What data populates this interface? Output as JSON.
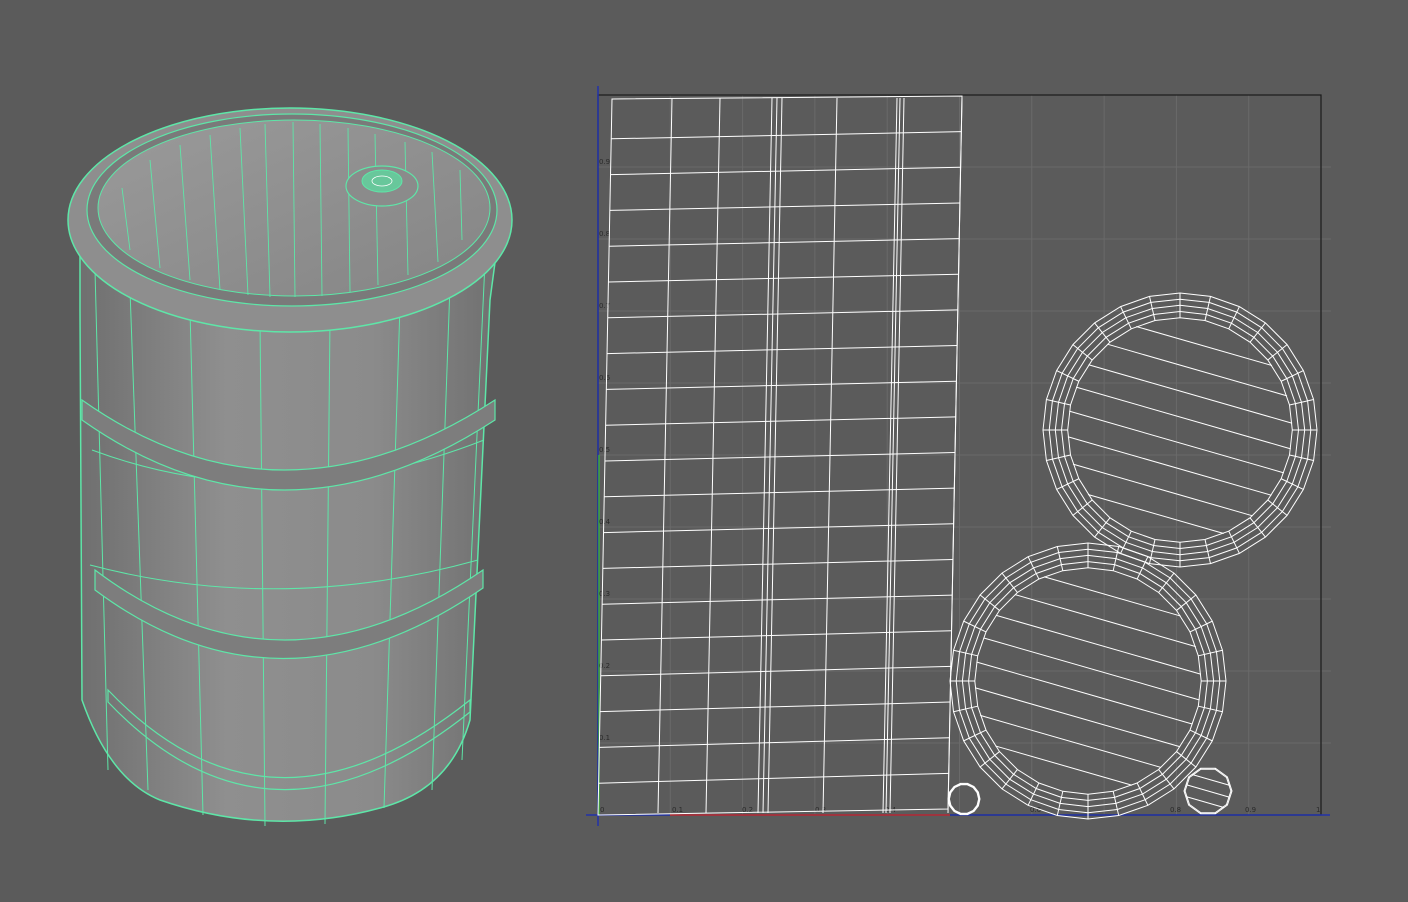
{
  "app": {
    "views": [
      {
        "name": "perspective-viewport",
        "content": "barrel-model"
      },
      {
        "name": "uv-texture-editor",
        "content": "uv-layout"
      }
    ]
  },
  "colors": {
    "background": "#5b5b5b",
    "wireframe_selected": "#5ee6a8",
    "barrel_surface": "#8a8a8a",
    "uv_wire": "#ffffff",
    "uv_grid": "#6a6a6a",
    "axis_u": "#2233aa",
    "axis_v_green": "#3ca83c",
    "axis_red": "#c0302a",
    "border_black": "#1a1a1a"
  },
  "uv_editor": {
    "u_ticks": [
      "0",
      "0.1",
      "0.2",
      "0.3",
      "0.4",
      "0.6",
      "0.8",
      "0.9",
      "1"
    ],
    "v_ticks": [
      "0.1",
      "0.2",
      "0.3",
      "0.4",
      "0.5",
      "0.6",
      "0.7",
      "0.8",
      "0.9"
    ]
  }
}
